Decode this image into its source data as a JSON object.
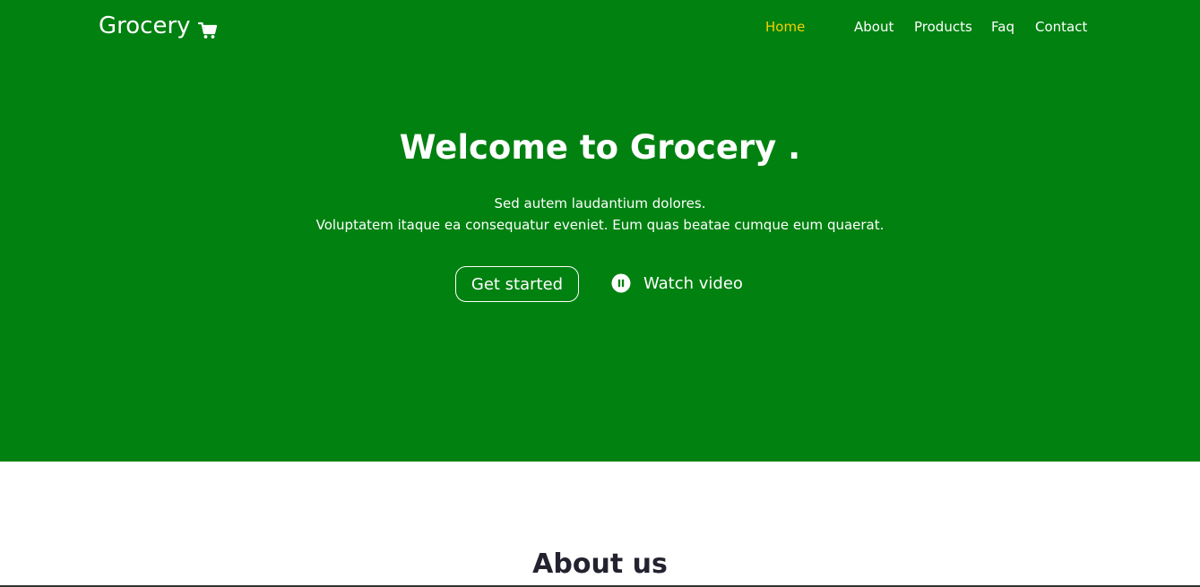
{
  "header": {
    "brand": "Grocery",
    "brand_icon": "shopping-cart-icon",
    "nav": {
      "home": "Home",
      "about": "About",
      "products": "Products",
      "faq": "Faq",
      "contact": "Contact"
    },
    "active_item": "Home"
  },
  "hero": {
    "title": "Welcome to Grocery .",
    "subtitle_line1": "Sed autem laudantium dolores.",
    "subtitle_line2": "Voluptatem itaque ea consequatur eveniet. Eum quas beatae cumque eum quaerat.",
    "primary_button": "Get started",
    "video_button": "Watch video",
    "video_icon": "pause-circle-icon"
  },
  "about": {
    "title": "About us"
  },
  "colors": {
    "hero_background": "#008110",
    "active_nav": "#f5d000",
    "text_light": "#ffffff",
    "heading_dark": "#232330"
  }
}
